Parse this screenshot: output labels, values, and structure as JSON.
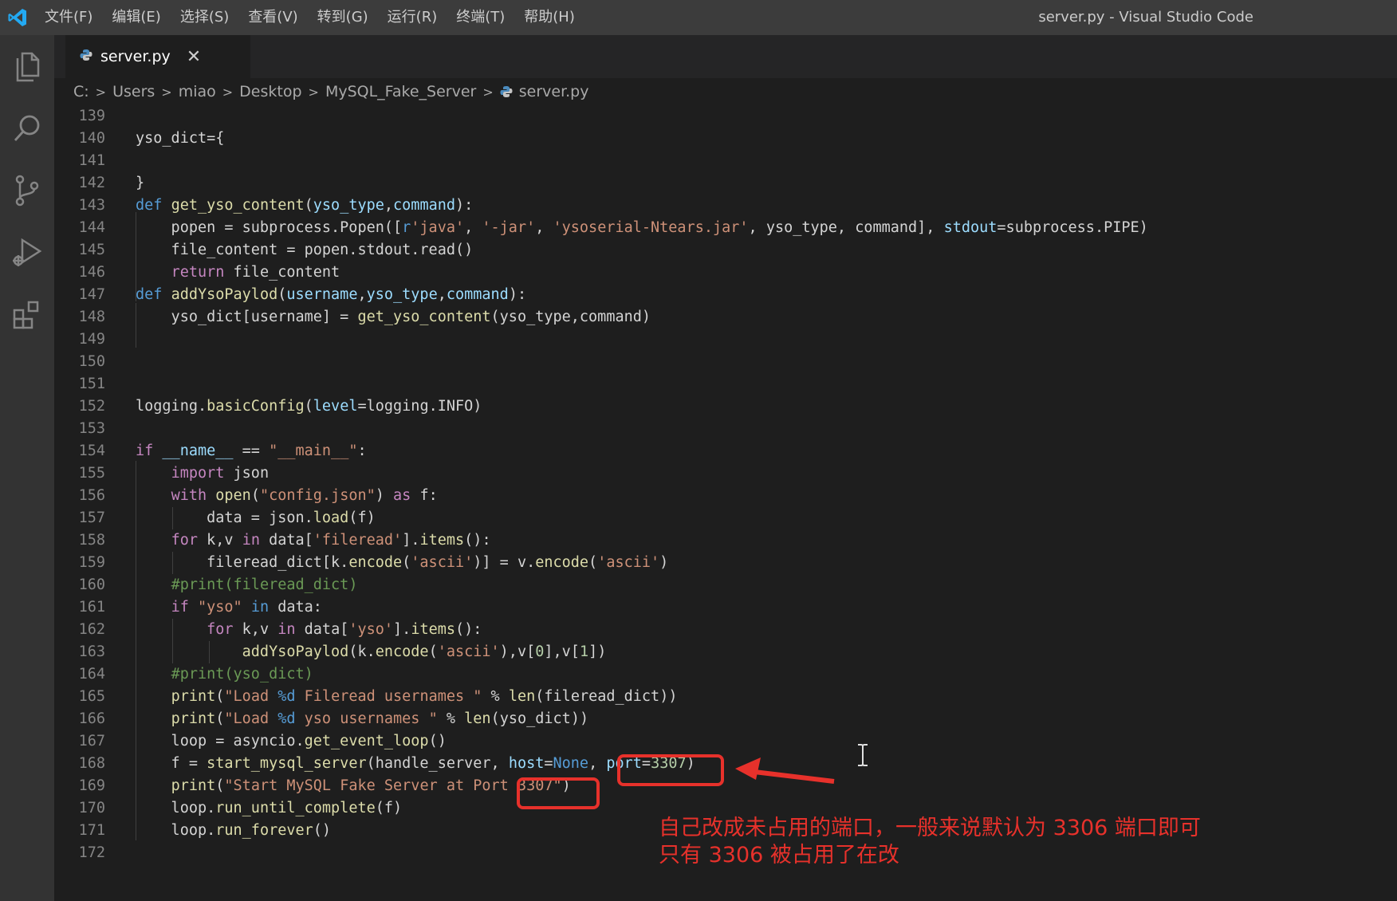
{
  "titlebar": {
    "menu": [
      "文件(F)",
      "编辑(E)",
      "选择(S)",
      "查看(V)",
      "转到(G)",
      "运行(R)",
      "终端(T)",
      "帮助(H)"
    ],
    "window_title": "server.py - Visual Studio Code"
  },
  "activitybar": {
    "icons": [
      "explorer-icon",
      "search-icon",
      "source-control-icon",
      "run-debug-icon",
      "extensions-icon"
    ]
  },
  "tab": {
    "label": "server.py",
    "close": "✕"
  },
  "breadcrumb": [
    "C:",
    "Users",
    "miao",
    "Desktop",
    "MySQL_Fake_Server",
    "server.py"
  ],
  "editor": {
    "line_numbers": [
      "139",
      "140",
      "141",
      "142",
      "143",
      "144",
      "145",
      "146",
      "147",
      "148",
      "149",
      "150",
      "151",
      "152",
      "153",
      "154",
      "155",
      "156",
      "157",
      "158",
      "159",
      "160",
      "161",
      "162",
      "163",
      "164",
      "165",
      "166",
      "167",
      "168",
      "169",
      "170",
      "171",
      "172"
    ]
  },
  "annotation": {
    "line1": "自己改成未占用的端口，一般来说默认为 3306 端口即可",
    "line2": "只有 3306 被占用了在改"
  },
  "colors": {
    "annotation": "#e7312b",
    "editor_bg": "#1e1e1e",
    "keyword": "#569cd6",
    "function": "#dcdcaa",
    "string": "#ce9178"
  }
}
